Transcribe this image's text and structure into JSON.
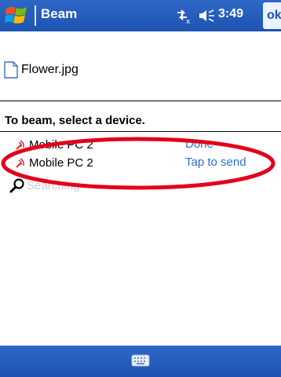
{
  "titlebar": {
    "app_title": "Beam",
    "clock": "3:49",
    "ok_label": "ok",
    "icons": {
      "start": "windows-flag-icon",
      "connectivity": "connectivity-icon",
      "volume": "speaker-icon"
    }
  },
  "file": {
    "name": "Flower.jpg",
    "icon": "document-icon"
  },
  "instruction": "To beam, select a device.",
  "devices": [
    {
      "name": "Mobile PC 2",
      "status": "Done",
      "icon": "infrared-icon"
    },
    {
      "name": "Mobile PC 2",
      "status": "Tap to send",
      "icon": "infrared-icon"
    }
  ],
  "searching": {
    "label": "Searching",
    "icon": "magnifier-icon"
  },
  "bottombar": {
    "icon": "keyboard-icon"
  },
  "colors": {
    "bar_blue": "#1d53b2",
    "status_blue": "#2f6fd6",
    "annotation_red": "#e3001b"
  }
}
